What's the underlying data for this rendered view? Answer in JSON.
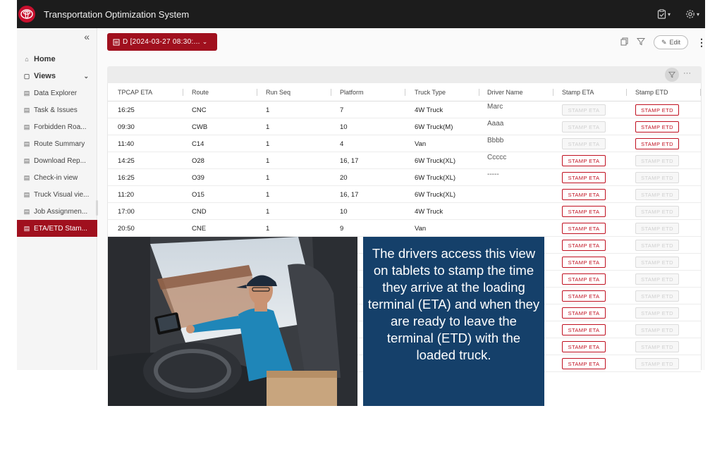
{
  "app": {
    "title": "Transportation Optimization System",
    "logo_icon": "toyota-logo-icon",
    "brand_color": "#c8102e"
  },
  "topbar": {
    "icons": [
      "clipboard-check-icon",
      "gear-icon"
    ]
  },
  "sidebar": {
    "collapse_glyph": "«",
    "items": [
      {
        "label": "Home",
        "icon": "home-icon",
        "glyph": "⌂"
      },
      {
        "label": "Views",
        "icon": "file-icon",
        "glyph": "▢"
      },
      {
        "label": "Data Explorer",
        "icon": "view-icon",
        "glyph": "▤"
      },
      {
        "label": "Task & Issues",
        "icon": "view-icon",
        "glyph": "▤"
      },
      {
        "label": "Forbidden Roa...",
        "icon": "view-icon",
        "glyph": "▤"
      },
      {
        "label": "Route Summary",
        "icon": "view-icon",
        "glyph": "▤"
      },
      {
        "label": "Download Rep...",
        "icon": "view-icon",
        "glyph": "▤"
      },
      {
        "label": "Check-in view",
        "icon": "view-icon",
        "glyph": "▤"
      },
      {
        "label": "Truck Visual vie...",
        "icon": "view-icon",
        "glyph": "▤"
      },
      {
        "label": "Job Assignmen...",
        "icon": "view-icon",
        "glyph": "▤"
      },
      {
        "label": "ETA/ETD Stam...",
        "icon": "view-icon",
        "glyph": "▤"
      }
    ]
  },
  "toolbar": {
    "view_select": "D [2024-03-27 08:30:...",
    "edit_label": "Edit",
    "more_glyph": "⋮"
  },
  "grid": {
    "columns": [
      "TPCAP ETA",
      "Route",
      "Run Seq",
      "Platform",
      "Truck Type",
      "Driver Name",
      "Stamp ETA",
      "Stamp ETD"
    ],
    "stamp_eta_label": "STAMP ETA",
    "stamp_etd_label": "STAMP ETD",
    "rows": [
      {
        "eta": "16:25",
        "route": "CNC",
        "seq": "1",
        "platform": "7",
        "truck": "4W Truck",
        "driver": "Marc",
        "eta_active": false,
        "etd_active": true
      },
      {
        "eta": "09:30",
        "route": "CWB",
        "seq": "1",
        "platform": "10",
        "truck": "6W Truck(M)",
        "driver": "Aaaa",
        "eta_active": false,
        "etd_active": true
      },
      {
        "eta": "11:40",
        "route": "C14",
        "seq": "1",
        "platform": "4",
        "truck": "Van",
        "driver": "Bbbb",
        "eta_active": false,
        "etd_active": true
      },
      {
        "eta": "14:25",
        "route": "O28",
        "seq": "1",
        "platform": "16, 17",
        "truck": "6W Truck(XL)",
        "driver": "Ccccc",
        "eta_active": true,
        "etd_active": false
      },
      {
        "eta": "16:25",
        "route": "O39",
        "seq": "1",
        "platform": "20",
        "truck": "6W Truck(XL)",
        "driver": "-----",
        "eta_active": true,
        "etd_active": false
      },
      {
        "eta": "11:20",
        "route": "O15",
        "seq": "1",
        "platform": "16, 17",
        "truck": "6W Truck(XL)",
        "driver": "",
        "eta_active": true,
        "etd_active": false
      },
      {
        "eta": "17:00",
        "route": "CND",
        "seq": "1",
        "platform": "10",
        "truck": "4W Truck",
        "driver": "",
        "eta_active": true,
        "etd_active": false
      },
      {
        "eta": "20:50",
        "route": "CNE",
        "seq": "1",
        "platform": "9",
        "truck": "Van",
        "driver": "",
        "eta_active": true,
        "etd_active": false
      },
      {
        "eta": "",
        "route": "",
        "seq": "",
        "platform": "",
        "truck": "",
        "driver": "",
        "eta_active": true,
        "etd_active": false
      },
      {
        "eta": "",
        "route": "",
        "seq": "",
        "platform": "",
        "truck": "",
        "driver": "",
        "eta_active": true,
        "etd_active": false
      },
      {
        "eta": "",
        "route": "",
        "seq": "",
        "platform": "",
        "truck": "",
        "driver": "",
        "eta_active": true,
        "etd_active": false
      },
      {
        "eta": "",
        "route": "",
        "seq": "",
        "platform": "",
        "truck": "",
        "driver": "",
        "eta_active": true,
        "etd_active": false
      },
      {
        "eta": "",
        "route": "",
        "seq": "",
        "platform": "",
        "truck": "",
        "driver": "",
        "eta_active": true,
        "etd_active": false
      },
      {
        "eta": "",
        "route": "",
        "seq": "",
        "platform": "",
        "truck": "",
        "driver": "",
        "eta_active": true,
        "etd_active": false
      },
      {
        "eta": "",
        "route": "",
        "seq": "",
        "platform": "",
        "truck": "",
        "driver": "",
        "eta_active": true,
        "etd_active": false
      },
      {
        "eta": "",
        "route": "",
        "seq": "",
        "platform": "",
        "truck": "",
        "driver": "",
        "eta_active": true,
        "etd_active": false
      }
    ]
  },
  "callout": {
    "text": "The drivers access this view on tablets to stamp the time they arrive at the loading terminal (ETA) and when they are ready to leave the terminal (ETD) with the loaded truck."
  },
  "colors": {
    "accent": "#a0101e",
    "callout_bg": "#15406a",
    "topbar_bg": "#1c1c1c"
  }
}
